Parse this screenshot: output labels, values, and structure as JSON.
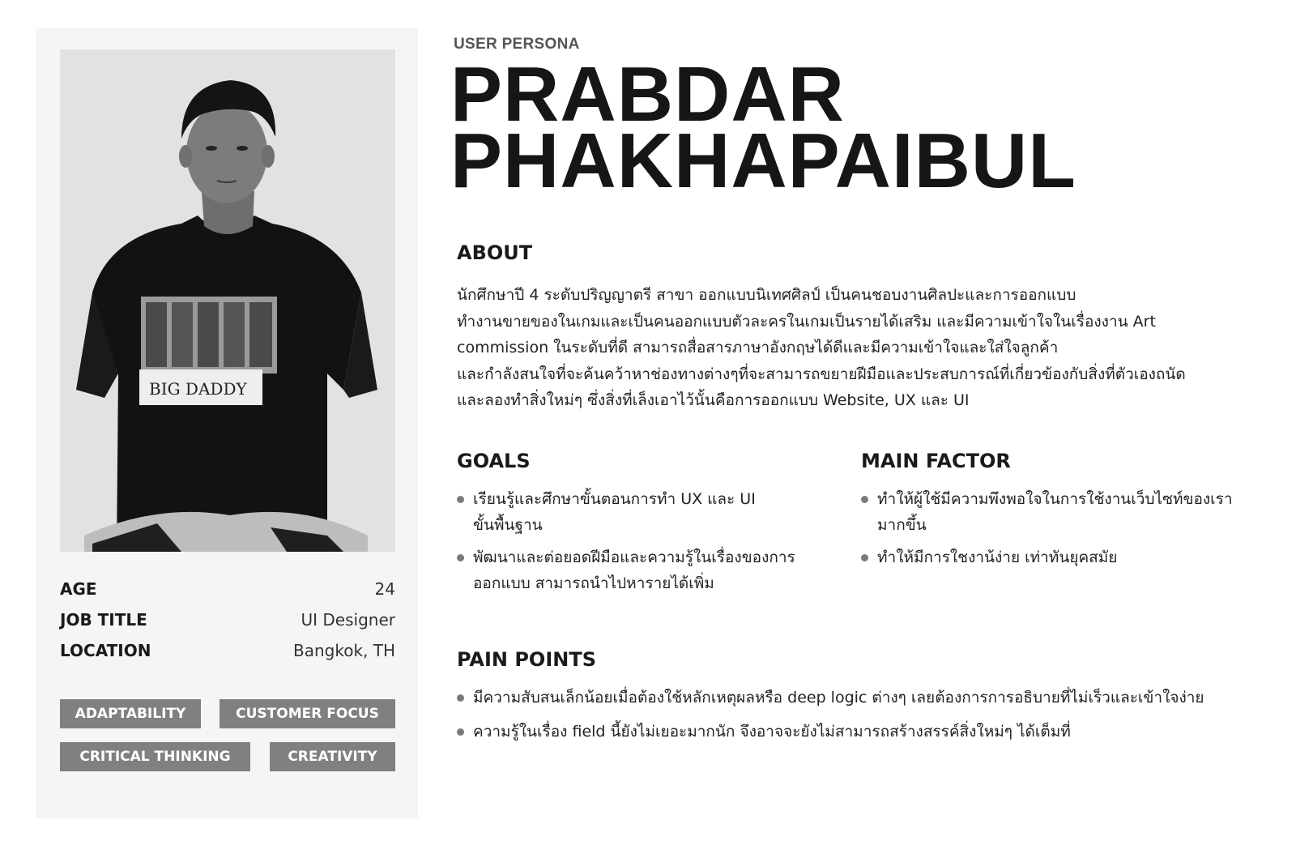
{
  "profile": {
    "photo": "portrait-photo",
    "info": [
      {
        "label": "AGE",
        "value": "24"
      },
      {
        "label": "JOB TITLE",
        "value": "UI Designer"
      },
      {
        "label": "LOCATION",
        "value": "Bangkok, TH"
      }
    ],
    "tags": [
      "ADAPTABILITY",
      "CUSTOMER FOCUS",
      "CRITICAL THINKING",
      "CREATIVITY"
    ]
  },
  "header": {
    "eyebrow": "USER PERSONA",
    "name_line1": "PRABDAR",
    "name_line2": "PHAKHAPAIBUL"
  },
  "about": {
    "title": "ABOUT",
    "lines": [
      "นักศึกษาปี 4 ระดับปริญญาตรี สาขา ออกแบบนิเทศศิลป์ เป็นคนชอบงานศิลปะและการออกแบบ",
      "ทำงานขายของในเกมและเป็นคนออกแบบตัวละครในเกมเป็นรายได้เสริม และมีความเข้าใจในเรื่องงาน Art",
      "commission ในระดับที่ดี สามารถสื่อสารภาษาอังกฤษได้ดีและมีความเข้าใจและใส่ใจลูกค้า",
      "และกำลังสนใจที่จะค้นคว้าหาช่องทางต่างๆที่จะสามารถขยายฝีมือและประสบการณ์ที่เกี่ยวข้องกับสิ่งที่ตัวเองถนัด",
      "และลองทำสิ่งใหม่ๆ ซึ่งสิ่งที่เล็งเอาไว้นั้นคือการออกแบบ Website, UX  และ UI"
    ]
  },
  "goals": {
    "title": "GOALS",
    "items": [
      {
        "line1": "เรียนรู้และศึกษาขั้นตอนการทำ UX และ UI",
        "line2": "ขั้นพื้นฐาน"
      },
      {
        "line1": "พัฒนาและต่อยอดฝีมือและความรู้ในเรื่องของการ",
        "line2": "ออกแบบ สามารถนำไปหารายได้เพิ่ม"
      }
    ]
  },
  "main_factor": {
    "title": "MAIN FACTOR",
    "items": [
      {
        "line1": "ทำให้ผู้ใช้มีความพึงพอใจในการใช้งานเว็บไซท์ของเรา",
        "line2": "มากขึ้น"
      },
      {
        "line1": "ทำให้มีการใชงาน้ง่าย เท่าทันยุคสมัย",
        "line2": ""
      }
    ]
  },
  "pain_points": {
    "title": "PAIN POINTS",
    "items": [
      "มีความสับสนเล็กน้อยเมื่อต้องใช้หลักเหตุผลหรือ deep logic ต่างๆ เลยต้องการการอธิบายที่ไม่เร็วและเข้าใจง่าย",
      "ความรู้ในเรื่อง field นี้ยังไม่เยอะมากนัก จึงอาจจะยังไม่สามารถสร้างสรรค์สิ่งใหม่ๆ ได้เต็มที่"
    ]
  },
  "colors": {
    "sidebar_bg": "#f5f5f5",
    "tag_bg": "#808080",
    "bullet": "#7a7a7a",
    "text": "#1a1a1a"
  }
}
